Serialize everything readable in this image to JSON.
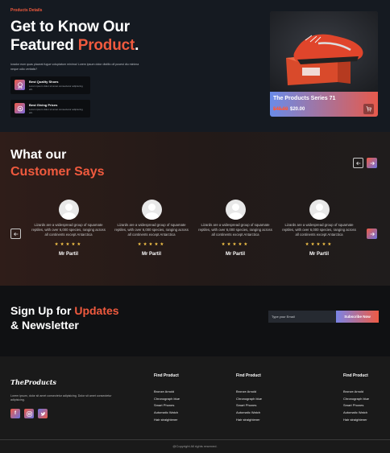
{
  "hero": {
    "eyebrow": "Products Details",
    "title_line1": "Get to Know Our",
    "title_line2_prefix": "Featured ",
    "title_line2_accent": "Product",
    "title_line2_suffix": ".",
    "description": "lorador eum quas placeat fugue voluptatum minima! Lorem ipsum dolor distillo ofi pusest diu minima neque odio veritatis?",
    "features": [
      {
        "icon": "award-icon",
        "title": "Best Quality Shoes",
        "text": "Lorem ipsum dolor sit amet consectetur adipiscing elit."
      },
      {
        "icon": "price-tag-icon",
        "title": "Best Giving Prices",
        "text": "Lorem ipsum dolor sit amet consectetur adipiscing elit."
      }
    ],
    "product": {
      "name": "The Products Series 71",
      "old_price": "$40.00",
      "new_price": "$20.00"
    }
  },
  "testimonials": {
    "title_line1": "What our",
    "title_line2": "Customer Says",
    "items": [
      {
        "text": "Lizards are a widespread group of squamate reptiles, with over 6,000 species, ranging across all continents except Antarctica",
        "stars": "★★★★★",
        "name": "Mr Partil"
      },
      {
        "text": "Lizards are a widespread group of squamate reptiles, with over 6,000 species, ranging across all continents except Antarctica",
        "stars": "★★★★★",
        "name": "Mr Partil"
      },
      {
        "text": "Lizards are a widespread group of squamate reptiles, with over 6,000 species, ranging across all continents except Antarctica",
        "stars": "★★★★★",
        "name": "Mr Partil"
      },
      {
        "text": "Lizards are a widespread group of squamate reptiles, with over 6,000 species, ranging across all continents except Antarctica",
        "stars": "★★★★★",
        "name": "Mr Partil"
      }
    ]
  },
  "newsletter": {
    "title_prefix": "Sign Up for ",
    "title_accent": "Updates",
    "title_line2": "& Newsletter",
    "email_placeholder": "Type your Email",
    "button": "Subscribe Now"
  },
  "footer": {
    "brand": "TheProducts",
    "description": "Lorem ipsum, dolor sit amet consectetur adipisicing. Dolor sit amet consectetur adipisicing.",
    "columns": [
      {
        "title": "Find Product",
        "items": [
          "Bronze Arnold",
          "Chronograph blue",
          "Smart Phones",
          "Automatic Watch",
          "Hair straightener"
        ]
      },
      {
        "title": "Find Product",
        "items": [
          "Bronze Arnold",
          "Chronograph blue",
          "Smart Phones",
          "Automatic Watch",
          "Hair straightener"
        ]
      },
      {
        "title": "Find Product",
        "items": [
          "Bronze Arnold",
          "Chronograph blue",
          "Smart Phones",
          "Automatic Watch",
          "Hair straightener"
        ]
      }
    ],
    "copyright": "@Copyright All rights reserved."
  },
  "colors": {
    "accent": "#f05a3e",
    "gradient_start": "#ef5b44",
    "gradient_end": "#6a73e0"
  }
}
